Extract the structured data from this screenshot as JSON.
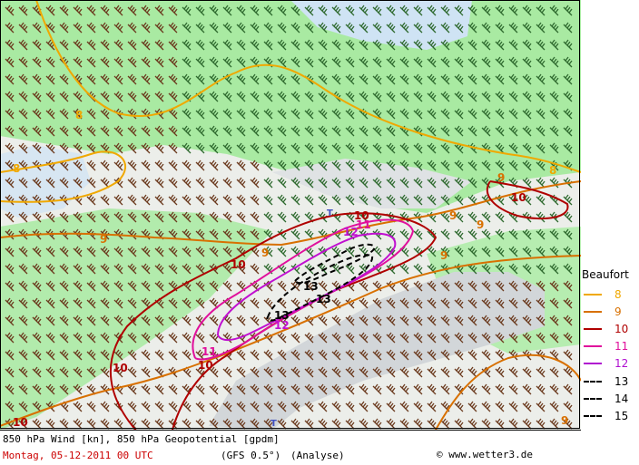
{
  "map": {
    "description_labels": {
      "contour_8": "8",
      "contour_9": "9",
      "contour_10": "10",
      "contour_11": "11",
      "contour_12": "12",
      "contour_13": "13",
      "city_marker": "T"
    }
  },
  "legend": {
    "title": "Beaufort",
    "items": [
      {
        "value": "8",
        "color": "#f0a800",
        "style": "solid"
      },
      {
        "value": "9",
        "color": "#d87000",
        "style": "solid"
      },
      {
        "value": "10",
        "color": "#b00000",
        "style": "solid"
      },
      {
        "value": "11",
        "color": "#e0109c",
        "style": "solid"
      },
      {
        "value": "12",
        "color": "#b010d0",
        "style": "solid"
      },
      {
        "value": "13",
        "color": "#000000",
        "style": "dashed"
      },
      {
        "value": "14",
        "color": "#000000",
        "style": "dashed"
      },
      {
        "value": "15",
        "color": "#000000",
        "style": "dashed"
      }
    ]
  },
  "footer": {
    "line1": "850 hPa Wind [kn], 850 hPa Geopotential [gpdm]",
    "date": "Montag, 05-12-2011  00 UTC",
    "model": "(GFS 0.5°)",
    "run": "(Analyse)",
    "copyright": "© www.wetter3.de"
  },
  "colors": {
    "land_green": "#a4e9a0",
    "barb_brown": "#6b3a1e",
    "barb_green": "#2f6a2f",
    "mountains": "#cfd3d6"
  }
}
